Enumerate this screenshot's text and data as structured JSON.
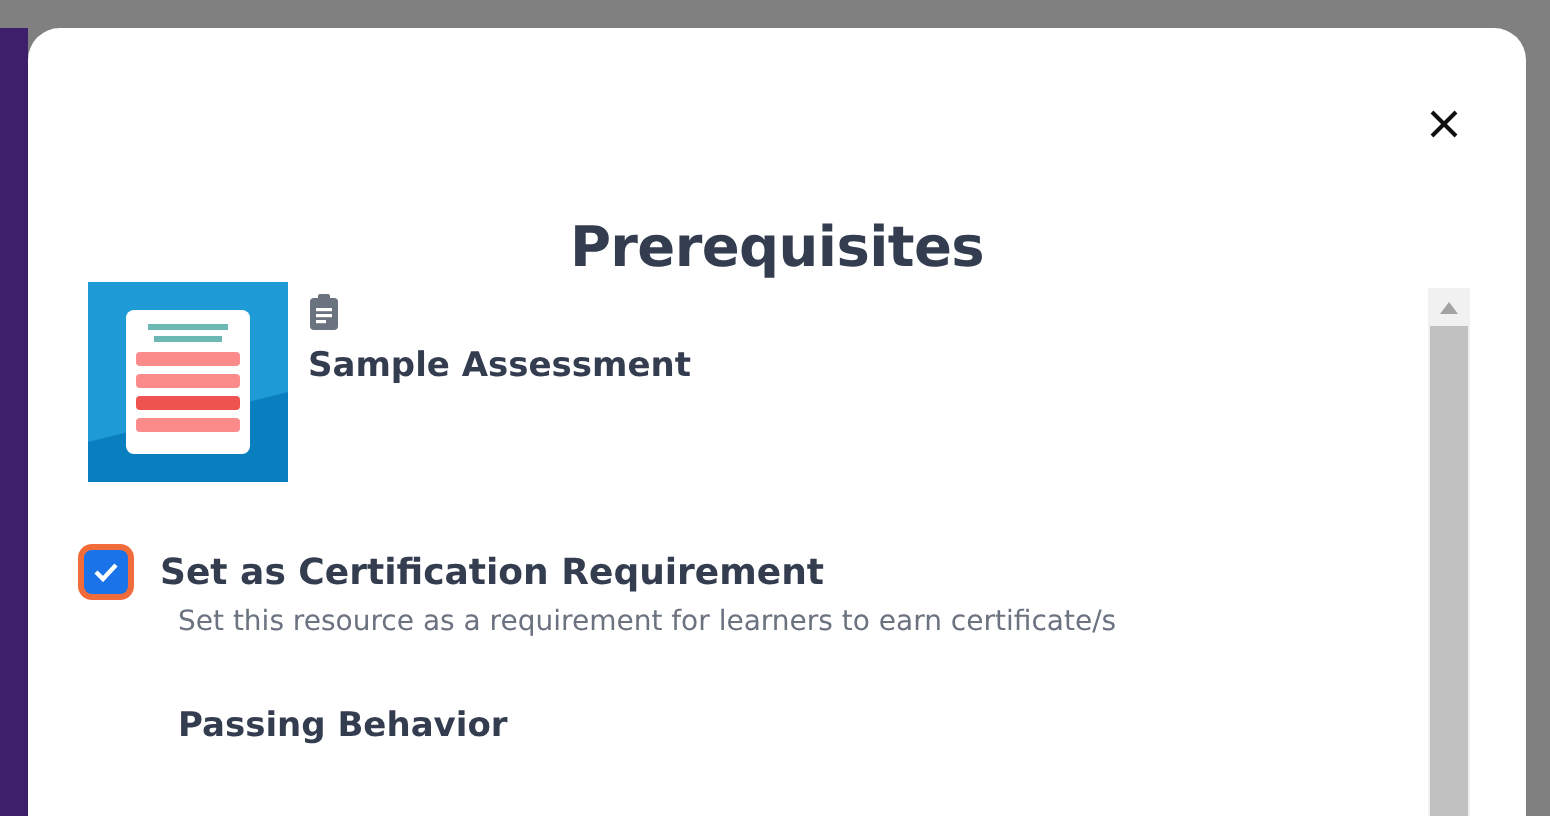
{
  "dialog": {
    "title": "Prerequisites"
  },
  "resource": {
    "title": "Sample Assessment"
  },
  "certification": {
    "label": "Set as Certification Requirement",
    "checked": true,
    "description": "Set this resource as a requirement for learners to earn certificate/s"
  },
  "passing_behavior": {
    "heading": "Passing Behavior"
  }
}
